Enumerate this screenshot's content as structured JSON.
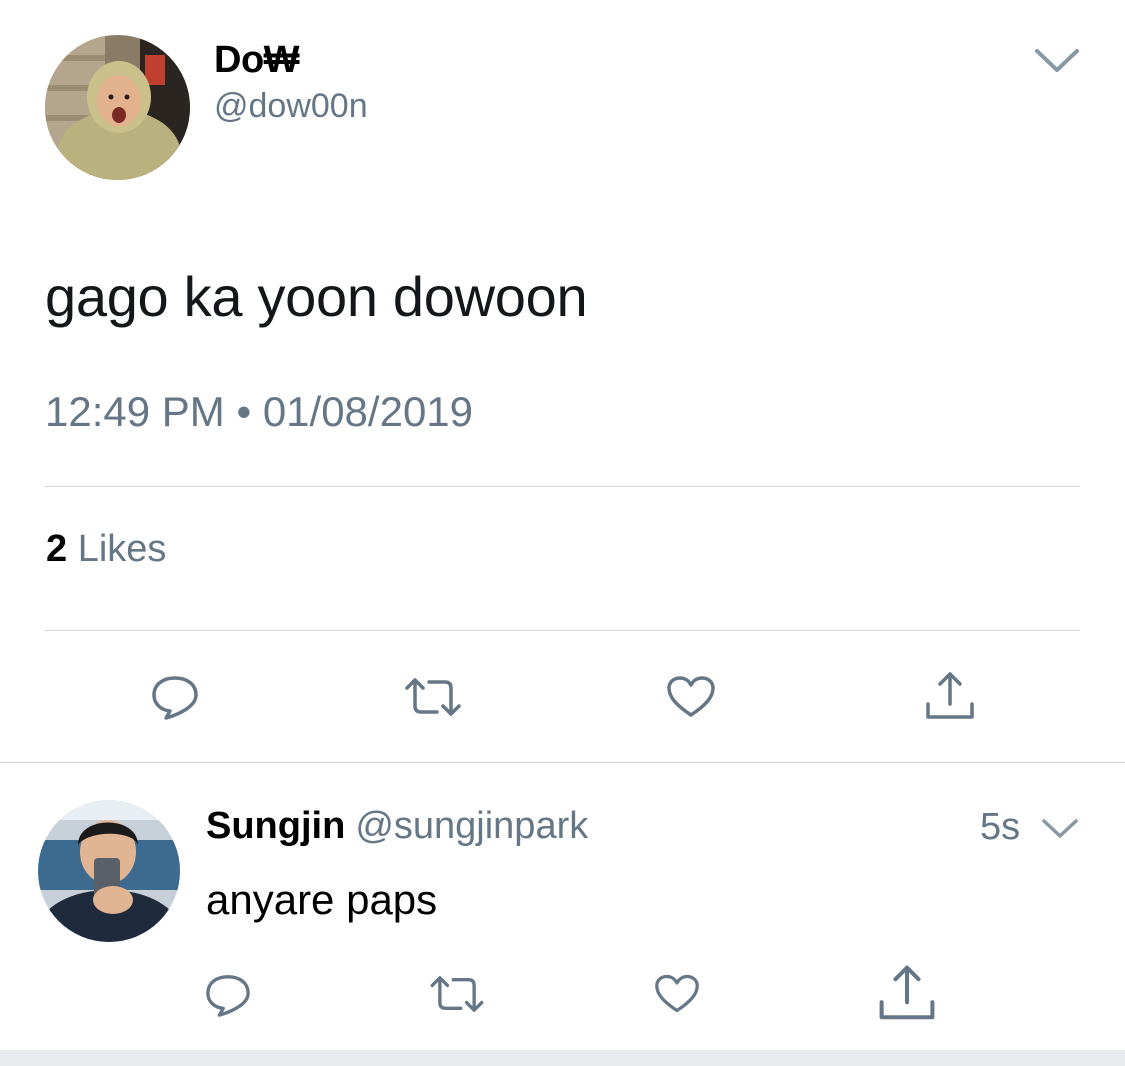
{
  "tweet": {
    "author": {
      "name": "Do₩",
      "handle": "@dow00n",
      "avatar_icon": "user-avatar-photo"
    },
    "menu_icon": "chevron-down-icon",
    "text": "gago ka yoon dowoon",
    "timestamp": "12:49 PM • 01/08/2019",
    "likes": {
      "count": "2",
      "label": "Likes"
    },
    "actions": [
      {
        "name": "reply",
        "icon": "reply-icon"
      },
      {
        "name": "retweet",
        "icon": "retweet-icon"
      },
      {
        "name": "like",
        "icon": "heart-icon"
      },
      {
        "name": "share",
        "icon": "share-icon"
      }
    ]
  },
  "reply": {
    "author": {
      "name": "Sungjin",
      "handle": "@sungjinpark",
      "avatar_icon": "user-avatar-photo"
    },
    "time": "5s",
    "menu_icon": "chevron-down-icon",
    "text": "anyare paps",
    "actions": [
      {
        "name": "reply",
        "icon": "reply-icon"
      },
      {
        "name": "retweet",
        "icon": "retweet-icon"
      },
      {
        "name": "like",
        "icon": "heart-icon"
      },
      {
        "name": "share",
        "icon": "share-icon"
      }
    ]
  },
  "colors": {
    "text_primary": "#14171a",
    "text_secondary": "#657786",
    "divider": "#d0d5d9",
    "icon": "#657786"
  }
}
